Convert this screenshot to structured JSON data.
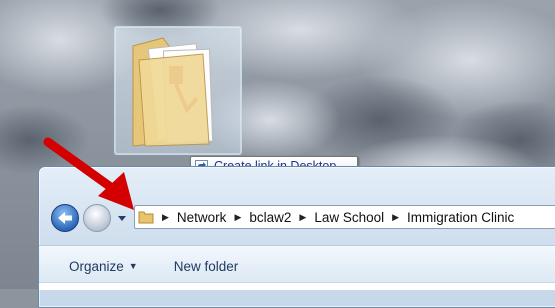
{
  "tooltip": {
    "text": "Create link in Desktop"
  },
  "address_bar": {
    "crumbs": [
      "Network",
      "bclaw2",
      "Law School",
      "Immigration Clinic"
    ]
  },
  "toolbar": {
    "organize_label": "Organize",
    "new_folder_label": "New folder"
  },
  "icons": {
    "back": "back-arrow-icon",
    "forward": "forward-arrow-icon",
    "recent": "chevron-down-icon",
    "folder": "folder-icon",
    "shortcut": "shortcut-arrow-icon"
  },
  "colors": {
    "annotation_arrow": "#d40000",
    "back_button": "#2d6fc4",
    "tooltip_text": "#1e3287"
  }
}
